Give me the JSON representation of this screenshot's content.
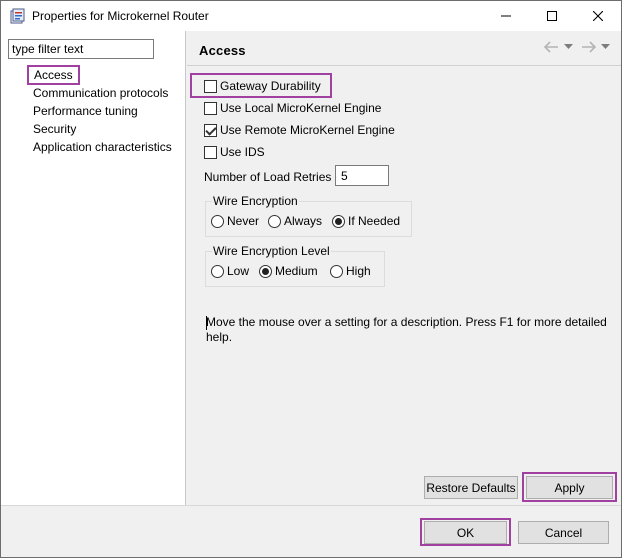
{
  "window": {
    "title": "Properties for Microkernel Router",
    "controls": {
      "minimize": "minimize-icon",
      "maximize": "maximize-icon",
      "close": "close-icon"
    }
  },
  "filter": {
    "value": "type filter text"
  },
  "tree": {
    "items": [
      {
        "label": "Access",
        "selected": true
      },
      {
        "label": "Communication protocols"
      },
      {
        "label": "Performance tuning"
      },
      {
        "label": "Security"
      },
      {
        "label": "Application characteristics"
      }
    ]
  },
  "page": {
    "title": "Access",
    "nav": {
      "back": "back-arrow-icon",
      "forward": "forward-arrow-icon"
    }
  },
  "settings": {
    "checkboxes": [
      {
        "label": "Gateway Durability",
        "checked": false
      },
      {
        "label": "Use Local MicroKernel Engine",
        "checked": false
      },
      {
        "label": "Use Remote MicroKernel Engine",
        "checked": true
      },
      {
        "label": "Use IDS",
        "checked": false
      }
    ],
    "load_retries": {
      "label": "Number of Load Retries",
      "value": "5"
    },
    "wire_encryption": {
      "legend": "Wire Encryption",
      "options": [
        {
          "label": "Never",
          "selected": false
        },
        {
          "label": "Always",
          "selected": false
        },
        {
          "label": "If Needed",
          "selected": true
        }
      ]
    },
    "wire_encryption_level": {
      "legend": "Wire Encryption Level",
      "options": [
        {
          "label": "Low",
          "selected": false
        },
        {
          "label": "Medium",
          "selected": true
        },
        {
          "label": "High",
          "selected": false
        }
      ]
    }
  },
  "help": "Move the mouse over a setting for a description. Press F1 for more detailed help.",
  "buttons": {
    "restore_defaults": "Restore Defaults",
    "apply": "Apply",
    "ok": "OK",
    "cancel": "Cancel"
  },
  "colors": {
    "highlight": "#a040a0",
    "button_face": "#e1e1e1",
    "dialog_bg": "#f0f0f0"
  }
}
